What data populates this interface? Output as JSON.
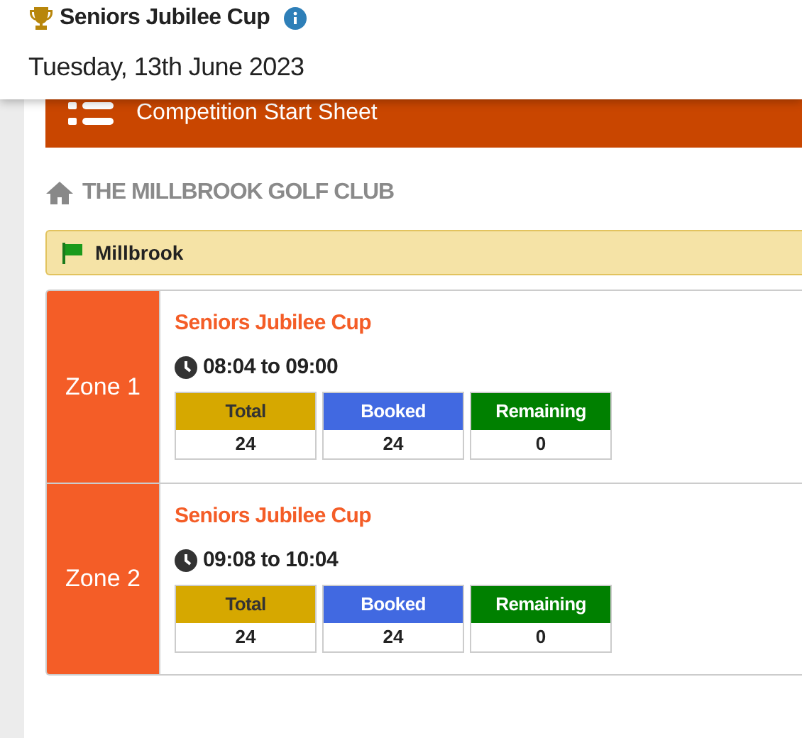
{
  "header": {
    "title": "Seniors Jubilee Cup",
    "date": "Tuesday, 13th June 2023"
  },
  "banner": {
    "title": "Competition Start Sheet"
  },
  "club": {
    "name": "THE MILLBROOK GOLF CLUB"
  },
  "course": {
    "name": "Millbrook"
  },
  "zones": [
    {
      "name": "Zone 1",
      "competition": "Seniors Jubilee Cup",
      "time": "08:04 to 09:00",
      "stats": [
        {
          "label": "Total",
          "value": "24",
          "color": "#d6a800"
        },
        {
          "label": "Booked",
          "value": "24",
          "color": "#4169e1"
        },
        {
          "label": "Remaining",
          "value": "0",
          "color": "#008000"
        }
      ]
    },
    {
      "name": "Zone 2",
      "competition": "Seniors Jubilee Cup",
      "time": "09:08 to 10:04",
      "stats": [
        {
          "label": "Total",
          "value": "24",
          "color": "#d6a800"
        },
        {
          "label": "Booked",
          "value": "24",
          "color": "#4169e1"
        },
        {
          "label": "Remaining",
          "value": "0",
          "color": "#008000"
        }
      ]
    }
  ]
}
